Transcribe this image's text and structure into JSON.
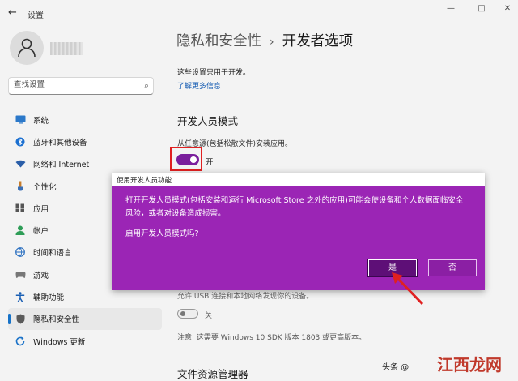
{
  "window": {
    "back_glyph": "←",
    "title": "设置",
    "controls": [
      "—",
      "□",
      "✕"
    ]
  },
  "sidebar": {
    "search_placeholder": "查找设置",
    "items": [
      {
        "label": "系统",
        "icon": "monitor-icon",
        "color": "#2b78c9"
      },
      {
        "label": "蓝牙和其他设备",
        "icon": "bluetooth-icon",
        "color": "#1a6fd0"
      },
      {
        "label": "网络和 Internet",
        "icon": "wifi-icon",
        "color": "#2a5ea8"
      },
      {
        "label": "个性化",
        "icon": "brush-icon",
        "color": "#c77c2a"
      },
      {
        "label": "应用",
        "icon": "apps-icon",
        "color": "#555555"
      },
      {
        "label": "帐户",
        "icon": "account-icon",
        "color": "#2e9d57"
      },
      {
        "label": "时间和语言",
        "icon": "globe-icon",
        "color": "#2a6fc0"
      },
      {
        "label": "游戏",
        "icon": "gamepad-icon",
        "color": "#777777"
      },
      {
        "label": "辅助功能",
        "icon": "accessibility-icon",
        "color": "#1a5fb4"
      },
      {
        "label": "隐私和安全性",
        "icon": "shield-icon",
        "color": "#5a5a5a",
        "active": true
      },
      {
        "label": "Windows 更新",
        "icon": "update-icon",
        "color": "#1a72c8"
      }
    ]
  },
  "main": {
    "breadcrumb": {
      "parent": "隐私和安全性",
      "separator": "›",
      "current": "开发者选项"
    },
    "info_text": "这些设置只用于开发。",
    "learn_more": "了解更多信息",
    "dev_mode": {
      "title": "开发人员模式",
      "description": "从任意源(包括松散文件)安装应用。",
      "toggle_state": "开"
    },
    "usb_desc": "允许 USB 连接和本地网络发现你的设备。",
    "usb_toggle_state": "关",
    "sdk_note": "注意: 这需要 Windows 10 SDK 版本 1803 或更高版本。",
    "file_explorer_title": "文件资源管理器"
  },
  "dialog": {
    "title": "使用开发人员功能",
    "message": "打开开发人员模式(包括安装和运行 Microsoft Store 之外的应用)可能会使设备和个人数据面临安全风险，或者对设备造成损害。",
    "question": "启用开发人员模式吗?",
    "yes_label": "是",
    "no_label": "否",
    "color": "#9b25b5"
  },
  "watermark": {
    "source": "头条 @",
    "logo": "江西龙网"
  }
}
